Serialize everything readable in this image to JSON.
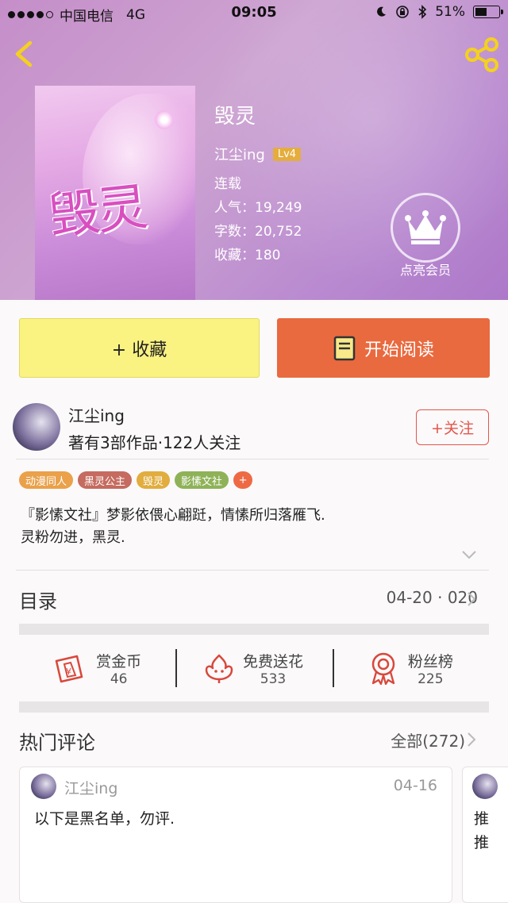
{
  "status_bar": {
    "carrier": "中国电信",
    "network": "4G",
    "time": "09:05",
    "battery": "51%",
    "battery_level": 0.51
  },
  "book": {
    "title": "毁灵",
    "author": "江尘ing",
    "level": "Lv4",
    "status": "连载",
    "popularity_label": "人气：",
    "popularity": "19,249",
    "words_label": "字数：",
    "words": "20,752",
    "favorites_label": "收藏：",
    "favorites": "180",
    "cover_art_text": "毁灵"
  },
  "vip": {
    "label": "点亮会员"
  },
  "actions": {
    "favorite_label": "+ 收藏",
    "read_label": "开始阅读"
  },
  "author_card": {
    "name": "江尘ing",
    "stats": "著有3部作品·122人关注",
    "follow_label": "+关注"
  },
  "tags": [
    {
      "label": "动漫同人",
      "color": "#eaa14a"
    },
    {
      "label": "黑灵公主",
      "color": "#c56b5f"
    },
    {
      "label": "毁灵",
      "color": "#e1ad3e"
    },
    {
      "label": "影愫文社",
      "color": "#8fb258"
    },
    {
      "label": "+",
      "color": "#ee6a44"
    }
  ],
  "description": {
    "line1": "『影愫文社』梦影依偎心翩跹，情愫所归落雁飞.",
    "line2": "灵粉勿进，黑灵."
  },
  "toc": {
    "label": "目录",
    "value": "04-20 · 020"
  },
  "stats": [
    {
      "icon": "red-envelope-icon",
      "name": "赏金币",
      "value": "46"
    },
    {
      "icon": "flower-icon",
      "name": "免费送花",
      "value": "533"
    },
    {
      "icon": "medal-icon",
      "name": "粉丝榜",
      "value": "225"
    }
  ],
  "comments": {
    "label": "热门评论",
    "all_label": "全部(272)",
    "items": [
      {
        "user": "江尘ing",
        "date": "04-16",
        "text": "以下是黑名单，勿评."
      },
      {
        "line1": "推",
        "line2": "推"
      }
    ]
  },
  "colors": {
    "header_gradient": [
      "#c58ec9",
      "#ad78c9"
    ],
    "accent_orange": "#e96a3f",
    "favorite_yellow": "#faf382",
    "follow_red": "#e2574c",
    "icon_red": "#d8483c",
    "lv_badge": "#e4ad3d"
  }
}
